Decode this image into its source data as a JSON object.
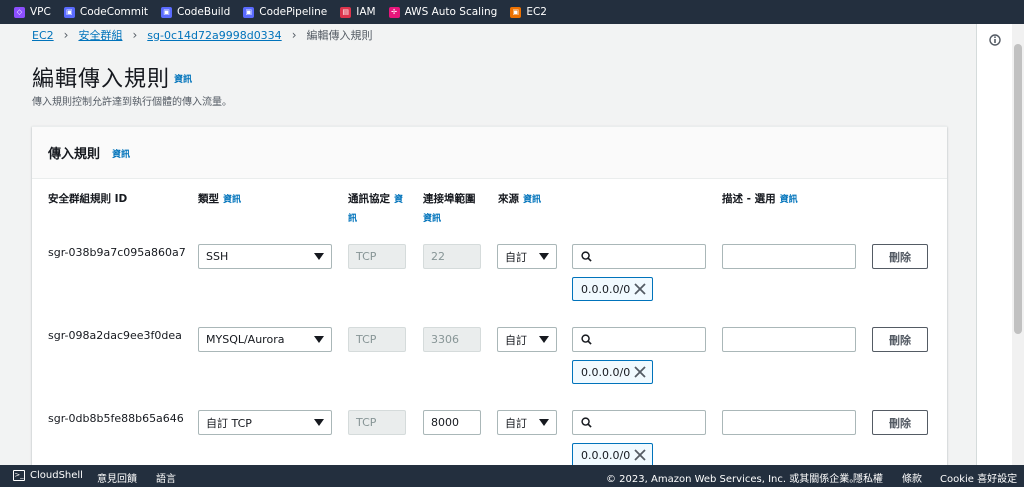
{
  "favorites": [
    {
      "label": "VPC",
      "color": "#8c4fff"
    },
    {
      "label": "CodeCommit",
      "color": "#5a6bff"
    },
    {
      "label": "CodeBuild",
      "color": "#5a6bff"
    },
    {
      "label": "CodePipeline",
      "color": "#5a6bff"
    },
    {
      "label": "IAM",
      "color": "#dd344c"
    },
    {
      "label": "AWS Auto Scaling",
      "color": "#e7157b"
    },
    {
      "label": "EC2",
      "color": "#ed7100"
    }
  ],
  "breadcrumb": {
    "items": [
      "EC2",
      "安全群組",
      "sg-0c14d72a9998d0334"
    ],
    "current": "編輯傳入規則"
  },
  "page": {
    "title": "編輯傳入規則",
    "info": "資訊",
    "description": "傳入規則控制允許達到執行個體的傳入流量。"
  },
  "panel": {
    "title": "傳入規則",
    "info": "資訊",
    "columns": {
      "rule_id": "安全群組規則 ID",
      "type": "類型",
      "protocol_a": "通訊協定",
      "protocol_b": "資",
      "protocol_c": "訊",
      "port": "連接埠範圍",
      "port_info": "資訊",
      "source": "來源",
      "desc": "描述 - 選用",
      "info": "資訊"
    },
    "rules": [
      {
        "id": "sgr-038b9a7c095a860a7",
        "type": "SSH",
        "protocol": "TCP",
        "port": "22",
        "port_editable": false,
        "source": "自訂",
        "cidr": "0.0.0.0/0",
        "delete": "刪除"
      },
      {
        "id": "sgr-098a2dac9ee3f0dea",
        "type": "MYSQL/Aurora",
        "protocol": "TCP",
        "port": "3306",
        "port_editable": false,
        "source": "自訂",
        "cidr": "0.0.0.0/0",
        "delete": "刪除"
      },
      {
        "id": "sgr-0db8b5fe88b65a646",
        "type": "自訂 TCP",
        "protocol": "TCP",
        "port": "8000",
        "port_editable": true,
        "source": "自訂",
        "cidr": "0.0.0.0/0",
        "delete": "刪除"
      }
    ]
  },
  "footer": {
    "cloudshell": "CloudShell",
    "feedback": "意見回饋",
    "language": "語言",
    "copyright": "© 2023, Amazon Web Services, Inc. 或其關係企業。",
    "privacy": "隱私權",
    "terms": "條款",
    "cookie": "Cookie 喜好設定"
  }
}
